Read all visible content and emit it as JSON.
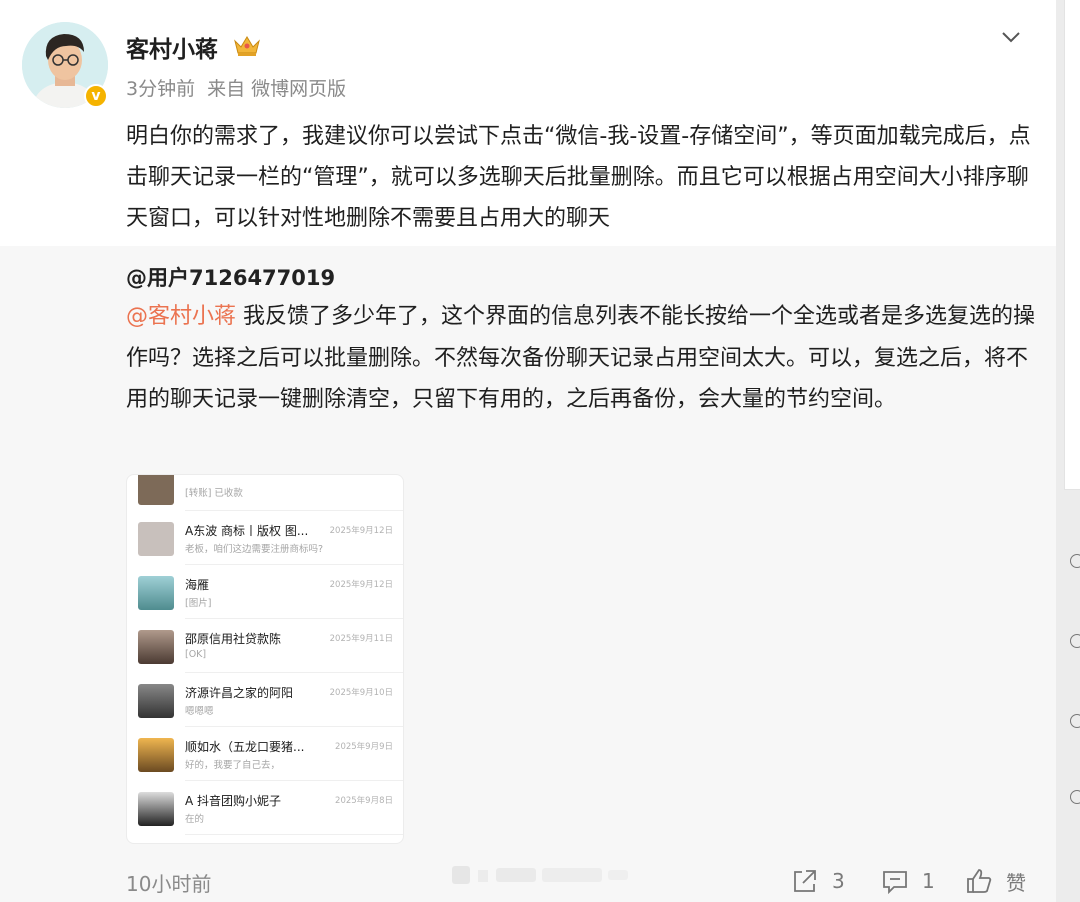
{
  "post": {
    "username": "客村小蒋",
    "verify_mark": "v",
    "time": "3分钟前",
    "source": "来自 微博网页版",
    "text": "明白你的需求了，我建议你可以尝试下点击“微信-我-设置-存储空间”，等页面加载完成后，点击聊天记录一栏的“管理”，就可以多选聊天后批量删除。而且它可以根据占用空间大小排序聊天窗口，可以针对性地删除不需要且占用大的聊天"
  },
  "retweet": {
    "author": "@用户7126477019",
    "mention": "@客村小蒋",
    "text": " 我反馈了多少年了，这个界面的信息列表不能长按给一个全选或者是多选复选的操作吗？选择之后可以批量删除。不然每次备份聊天记录占用空间太大。可以，复选之后，将不用的聊天记录一键删除清空，只留下有用的，之后再备份，会大量的节约空间。",
    "image": {
      "chats": [
        {
          "name": "[转账] 已收款",
          "msg": "",
          "date": "",
          "avatar_color": "#7d6a58"
        },
        {
          "name": "A东波 商标丨版权 图...",
          "msg": "老板，咱们这边需要注册商标吗?",
          "date": "2025年9月12日",
          "avatar_color": "#c8c0bc"
        },
        {
          "name": "海雁",
          "msg": "[图片]",
          "date": "2025年9月12日",
          "avatar_color": "#5b9aa0"
        },
        {
          "name": "邵原信用社贷款陈",
          "msg": "[OK]",
          "date": "2025年9月11日",
          "avatar_color": "#8c7668"
        },
        {
          "name": "济源许昌之家的阿阳",
          "msg": "嗯嗯嗯",
          "date": "2025年9月10日",
          "avatar_color": "#555555"
        },
        {
          "name": "顺如水（五龙口要猪...",
          "msg": "好的，我要了自己去，",
          "date": "2025年9月9日",
          "avatar_color": "#c88b3a"
        },
        {
          "name": "A 抖音团购小妮子",
          "msg": "在的",
          "date": "2025年9月8日",
          "avatar_color": "#2a2a2a"
        }
      ]
    }
  },
  "footer": {
    "time": "10小时前",
    "share_count": "3",
    "comment_count": "1",
    "like_label": "赞"
  }
}
